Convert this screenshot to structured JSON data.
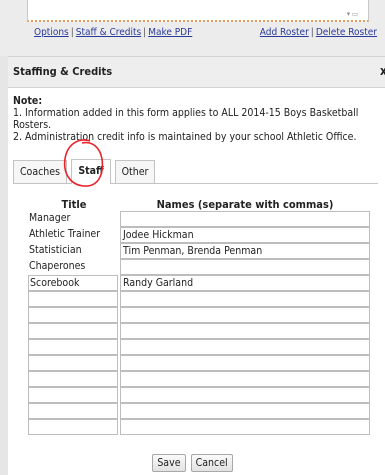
{
  "toolbar": {
    "links_left": [
      "Options",
      "Staff & Credits",
      "Make PDF"
    ],
    "separator": "|",
    "add_roster": "Add Roster",
    "delete_roster": "Delete Roster"
  },
  "dialog": {
    "title": "Staffing & Credits",
    "close_glyph": "x"
  },
  "note": {
    "heading": "Note:",
    "lines": [
      "1. Information added in this form applies to ALL 2014-15 Boys Basketball Rosters.",
      "2. Administration credit info is maintained by your school Athletic Office."
    ]
  },
  "tabs": [
    {
      "label": "Coaches",
      "active": false
    },
    {
      "label": "Staff",
      "active": true
    },
    {
      "label": "Other",
      "active": false
    }
  ],
  "table": {
    "col_title": "Title",
    "col_names": "Names (separate with commas)",
    "rows": [
      {
        "title": "Manager",
        "names": ""
      },
      {
        "title": "Athletic Trainer",
        "names": "Jodee Hickman"
      },
      {
        "title": "Statistician",
        "names": "Tim Penman, Brenda Penman"
      },
      {
        "title": "Chaperones",
        "names": ""
      },
      {
        "title": "Scorebook",
        "names": "Randy Garland"
      },
      {
        "title": "",
        "names": ""
      },
      {
        "title": "",
        "names": ""
      },
      {
        "title": "",
        "names": ""
      },
      {
        "title": "",
        "names": ""
      },
      {
        "title": "",
        "names": ""
      },
      {
        "title": "",
        "names": ""
      },
      {
        "title": "",
        "names": ""
      },
      {
        "title": "",
        "names": ""
      },
      {
        "title": "",
        "names": ""
      }
    ]
  },
  "buttons": {
    "save": "Save",
    "cancel": "Cancel"
  },
  "colors": {
    "annotation_circle": "#e8232a",
    "link": "#2a3a99",
    "dotted_border": "#e49b5c"
  }
}
